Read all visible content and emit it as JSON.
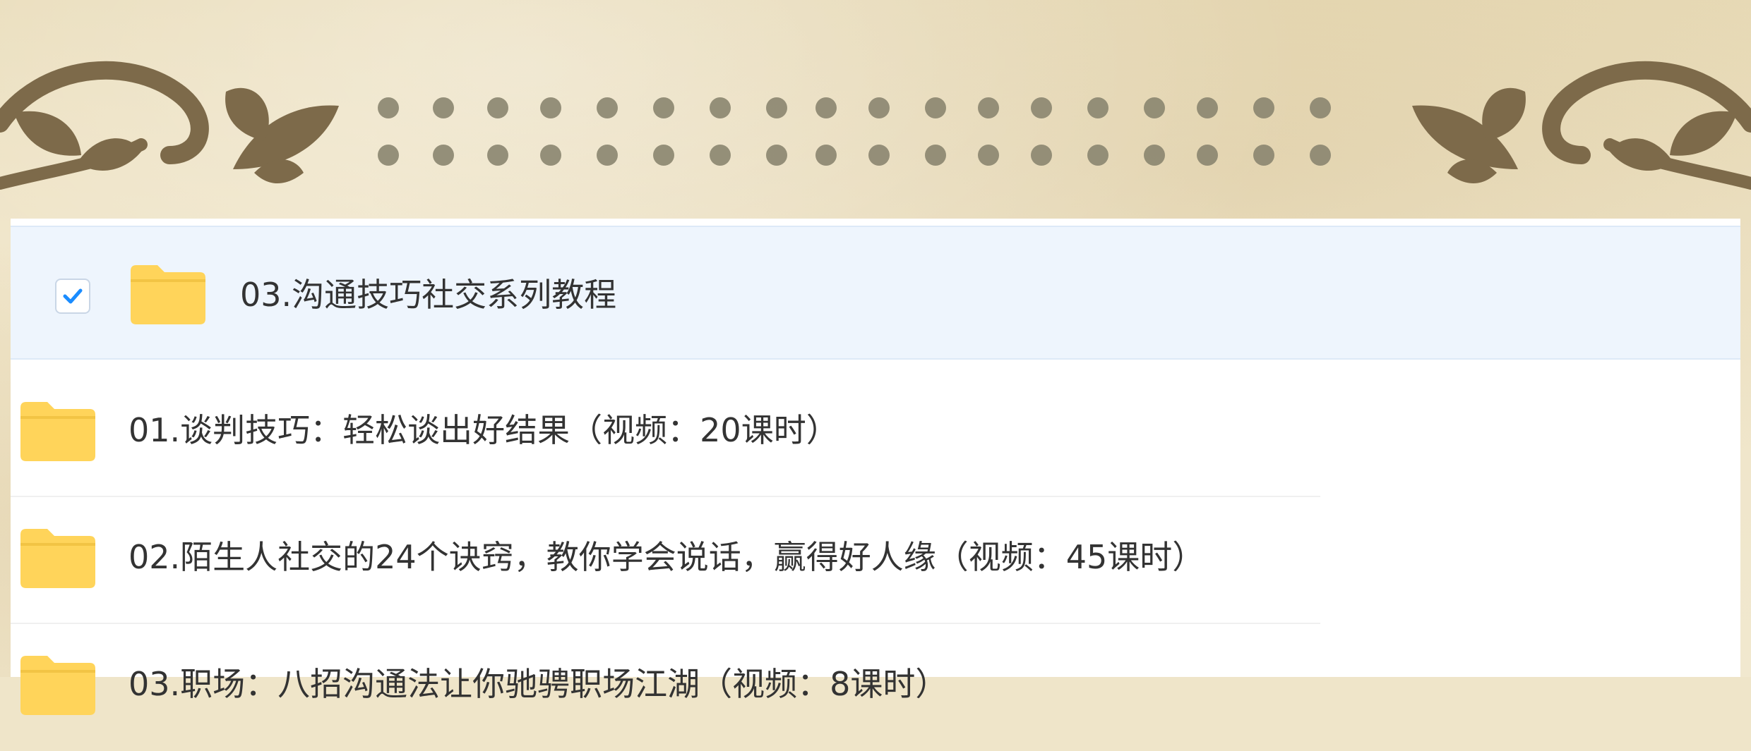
{
  "selected_folder": {
    "name": "03.沟通技巧社交系列教程",
    "checked": true
  },
  "folders": [
    {
      "name": "01.谈判技巧：轻松谈出好结果（视频：20课时）"
    },
    {
      "name": "02.陌生人社交的24个诀窍，教你学会说话，赢得好人缘（视频：45课时）"
    },
    {
      "name": "03.职场：八招沟通法让你驰骋职场江湖（视频：8课时）"
    }
  ],
  "colors": {
    "accent": "#1a8cff",
    "folder": "#ffd45a",
    "selected_row": "#eef5fd",
    "ornament": "#7d6a4a"
  },
  "icons": {
    "folder": "folder-icon",
    "check": "checkmark-icon"
  }
}
